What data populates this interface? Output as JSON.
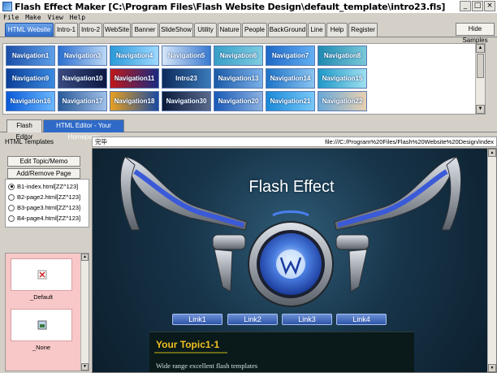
{
  "titlebar": {
    "title": "Flash Effect Maker [C:\\Program Files\\Flash Website Design\\default_template\\intro23.fls]"
  },
  "menu": [
    "File",
    "Make",
    "View",
    "Help"
  ],
  "tabs": [
    "HTML Website",
    "Intro-1",
    "Intro-2",
    "WebSite",
    "Banner",
    "SlideShow",
    "Utility",
    "Nature",
    "People",
    "BackGround",
    "Line",
    "Help",
    "Register"
  ],
  "hide_samples": "Hide Samples",
  "gallery": {
    "rows": [
      [
        "Navigation1",
        "Navigation3",
        "Navigation4",
        "Navigation5",
        "Navigation6",
        "Navigation7",
        "Navigation8"
      ],
      [
        "Navigation9",
        "Navigation10",
        "Navigation11",
        "Intro23",
        "Navigation13",
        "Navigation14",
        "Navigation15"
      ],
      [
        "Navigation16",
        "Navigation17",
        "Navigation18",
        "Navigation30",
        "Navigation20",
        "Navigation21",
        "Navigation22"
      ]
    ]
  },
  "editor_tabs": [
    "Flash Editor",
    "HTML Editor - Your Homepage"
  ],
  "left_panel": {
    "title": "HTML Templates",
    "edit_topic": "Edit Topic/Memo",
    "add_remove": "Add/Remove Page",
    "pages": [
      "B1-index.html[ZZ^123]",
      "B2-page2.html[ZZ^123]",
      "B3-page3.html[ZZ^123]",
      "B4-page4.html[ZZ^123]"
    ],
    "templates": [
      "_Default",
      "_None"
    ]
  },
  "browser": {
    "status": "完毕",
    "url": "file:///C:/Program%20Files/Flash%20Website%20Design/index",
    "flash_title": "Flash Effect",
    "links": [
      "Link1",
      "Link2",
      "Link3",
      "Link4"
    ],
    "topic_title": "Your Topic1-1",
    "topic_text": "Wide range excellent flash templates"
  }
}
